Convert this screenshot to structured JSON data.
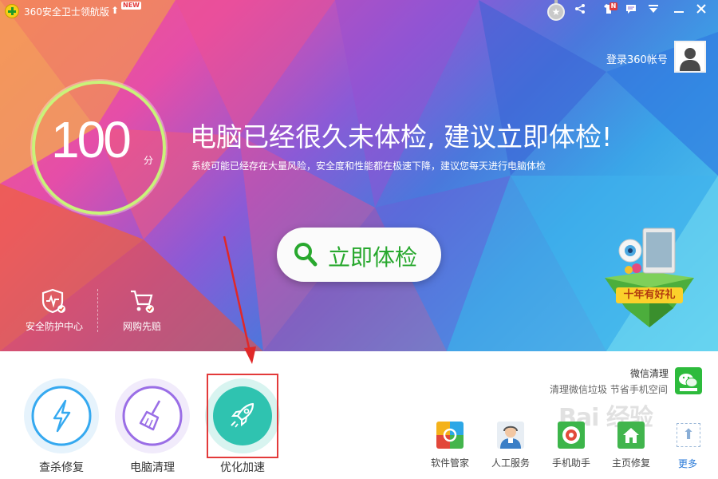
{
  "titlebar": {
    "title": "360安全卫士领航版",
    "new_badge": "NEW",
    "notify_badge": "N",
    "icons": [
      "medal-icon",
      "share-icon",
      "shirt-icon",
      "message-icon",
      "menu-icon",
      "minimize-icon",
      "close-icon"
    ]
  },
  "account": {
    "login_label": "登录360帐号"
  },
  "score": {
    "value": "100",
    "unit": "分",
    "ring_color": "#c9f37a"
  },
  "hero": {
    "headline": "电脑已经很久未体检, 建议立即体检!",
    "subline": "系统可能已经存在大量风险，安全度和性能都在极速下降，建议您每天进行电脑体检"
  },
  "scan_button": {
    "label": "立即体检",
    "color": "#28a82e"
  },
  "small_tools": [
    {
      "label": "安全防护中心",
      "icon": "shield-icon"
    },
    {
      "label": "网购先赔",
      "icon": "cart-icon"
    }
  ],
  "gift": {
    "label": "十年有好礼"
  },
  "big_tools": [
    {
      "label": "查杀修复",
      "icon": "lightning-icon",
      "color": "#35a9f0"
    },
    {
      "label": "电脑清理",
      "icon": "broom-icon",
      "color": "#9a6ee6"
    },
    {
      "label": "优化加速",
      "icon": "rocket-icon",
      "color": "#2fc3b0"
    }
  ],
  "wechat": {
    "title": "微信清理",
    "subtitle": "清理微信垃圾 节省手机空间"
  },
  "apps": [
    {
      "label": "软件管家",
      "icon": "software-manager-icon"
    },
    {
      "label": "人工服务",
      "icon": "support-agent-icon"
    },
    {
      "label": "手机助手",
      "icon": "phone-assistant-icon"
    },
    {
      "label": "主页修复",
      "icon": "homepage-repair-icon"
    }
  ],
  "more": {
    "label": "更多"
  },
  "watermark": "Bai 经验"
}
